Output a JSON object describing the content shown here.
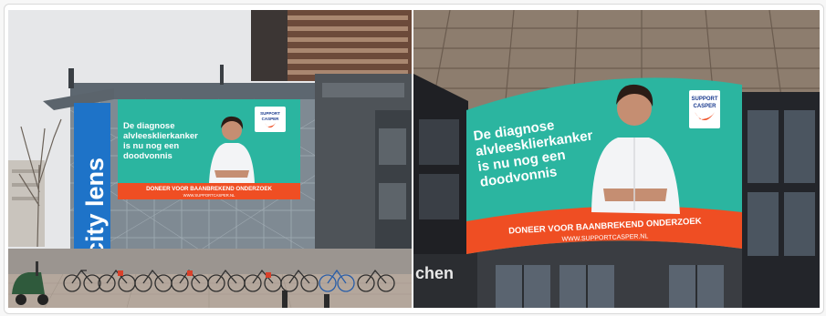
{
  "photos": [
    {
      "building_sign": "city lens",
      "billboard": {
        "headline": [
          "De diagnose",
          "alvleesklierkanker",
          "is nu nog een",
          "doodvonnis"
        ],
        "cta": "DONEER VOOR BAANBREKEND ONDERZOEK",
        "url": "WWW.SUPPORTCASPER.NL",
        "logo": [
          "SUPPORT",
          "CASPER"
        ]
      }
    },
    {
      "storefront_sign": "chen",
      "billboard": {
        "headline": [
          "De diagnose",
          "alvleesklierkanker",
          "is nu nog een",
          "doodvonnis"
        ],
        "cta": "DONEER VOOR BAANBREKEND ONDERZOEK",
        "url": "WWW.SUPPORTCASPER.NL",
        "logo": [
          "SUPPORT",
          "CASPER"
        ]
      }
    }
  ],
  "colors": {
    "billboard_teal": "#2bb5a0",
    "billboard_orange": "#ef4e23",
    "sign_blue": "#1e73c8",
    "sky": "#e6e7e9"
  }
}
